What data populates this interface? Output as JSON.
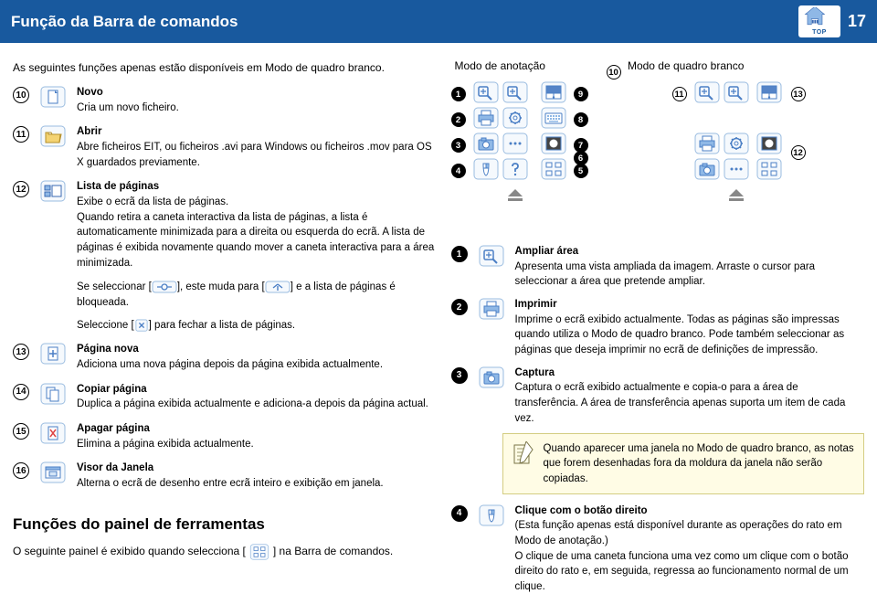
{
  "header": {
    "title": "Função da Barra de comandos",
    "page": "17",
    "badge": "TOP"
  },
  "left": {
    "intro": "As seguintes funções apenas estão disponíveis em Modo de quadro branco.",
    "f10": {
      "title": "Novo",
      "desc": "Cria um novo ficheiro."
    },
    "f11": {
      "title": "Abrir",
      "desc": "Abre ficheiros EIT, ou ficheiros .avi para Windows ou ficheiros .mov para OS X guardados previamente."
    },
    "f12": {
      "title": "Lista de páginas",
      "desc1": "Exibe o ecrã da lista de páginas.",
      "desc2": "Quando retira a caneta interactiva da lista de páginas, a lista é automaticamente minimizada para a direita ou esquerda do ecrã. A lista de páginas é exibida novamente quando mover a caneta interactiva para a área minimizada.",
      "desc3a": "Se seleccionar [",
      "desc3b": "], este muda para [",
      "desc3c": "] e a lista de páginas é bloqueada.",
      "desc4a": "Seleccione [",
      "desc4b": "] para fechar a lista de páginas."
    },
    "f13": {
      "title": "Página nova",
      "desc": "Adiciona uma nova página depois da página exibida actualmente."
    },
    "f14": {
      "title": "Copiar página",
      "desc": "Duplica a página exibida actualmente e adiciona-a depois da página actual."
    },
    "f15": {
      "title": "Apagar página",
      "desc": "Elimina a página exibida actualmente."
    },
    "f16": {
      "title": "Visor da Janela",
      "desc": "Alterna o ecrã de desenho entre ecrã inteiro e exibição em janela."
    },
    "section": "Funções do painel de ferramentas",
    "bottom_a": "O seguinte painel é exibido quando selecciona [",
    "bottom_b": "] na Barra de comandos."
  },
  "right": {
    "mode1": "Modo de anotação",
    "mode2": "Modo de quadro branco",
    "i1": {
      "title": "Ampliar área",
      "desc": "Apresenta uma vista ampliada da imagem. Arraste o cursor para seleccionar a área que pretende ampliar."
    },
    "i2": {
      "title": "Imprimir",
      "desc": "Imprime o ecrã exibido actualmente. Todas as páginas são impressas quando utiliza o Modo de quadro branco. Pode também seleccionar as páginas que deseja imprimir no ecrã de definições de impressão."
    },
    "i3": {
      "title": "Captura",
      "desc": "Captura o ecrã exibido actualmente e copia-o para a área de transferência. A área de transferência apenas suporta um item de cada vez."
    },
    "note": "Quando aparecer uma janela no Modo de quadro branco, as notas que forem desenhadas fora da moldura da janela não serão copiadas.",
    "i4": {
      "title": "Clique com o botão direito",
      "desc1": "(Esta função apenas está disponível durante as operações do rato em Modo de anotação.)",
      "desc2": "O clique de uma caneta funciona uma vez como um clique com o botão direito do rato e, em seguida, regressa ao funcionamento normal de um clique."
    }
  }
}
